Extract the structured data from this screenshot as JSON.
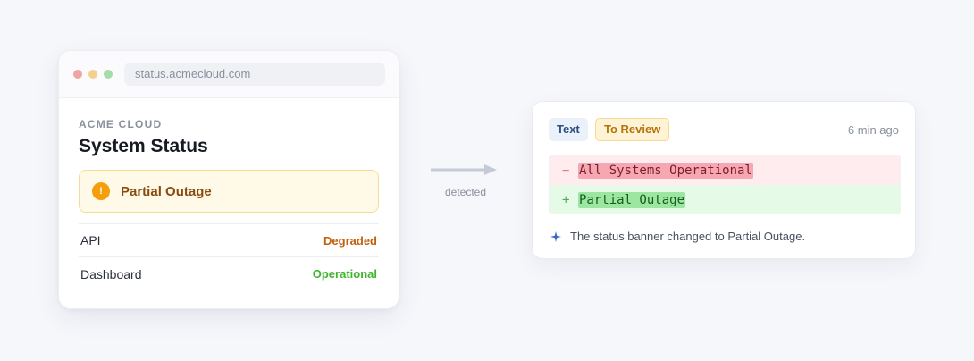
{
  "browser": {
    "url": "status.acmecloud.com",
    "eyebrow": "ACME CLOUD",
    "title": "System Status",
    "banner": "Partial Outage",
    "rows": [
      {
        "name": "API",
        "status": "Degraded"
      },
      {
        "name": "Dashboard",
        "status": "Operational"
      }
    ]
  },
  "arrow": {
    "label": "detected"
  },
  "change": {
    "type_tag": "Text",
    "state_tag": "To Review",
    "time": "6 min ago",
    "removed_sign": "−",
    "removed": "All Systems Operational",
    "added_sign": "+",
    "added": "Partial Outage",
    "summary": "The status banner changed to Partial Outage."
  },
  "colors": {
    "warning": "#f59e0b",
    "degraded": "#c2600c",
    "operational": "#3eb52e",
    "diff_removed": "#ffecee",
    "diff_added": "#e6fbe7"
  },
  "icons": {
    "window_dots": [
      "close-dot",
      "minimize-dot",
      "zoom-dot"
    ],
    "banner": "warning-icon",
    "summary": "sparkle-icon",
    "flow": "arrow-right-icon"
  }
}
